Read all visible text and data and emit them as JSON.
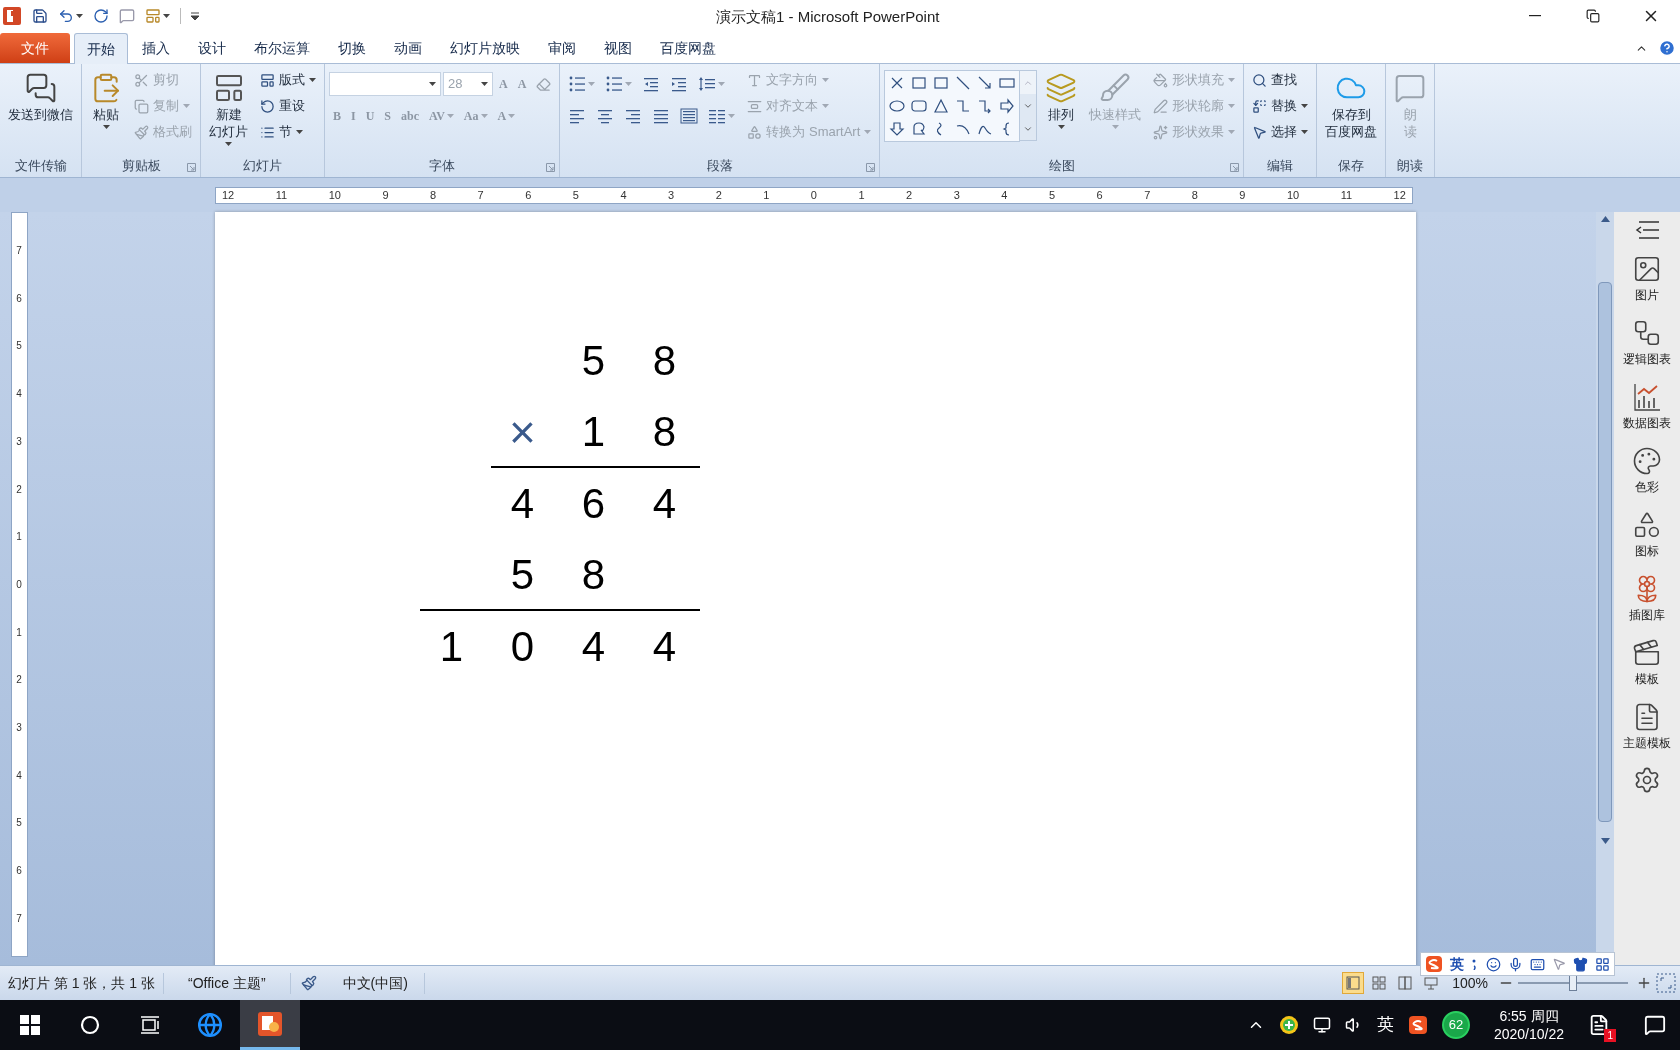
{
  "window": {
    "title": "演示文稿1 - Microsoft PowerPoint"
  },
  "tabs": [
    {
      "label": "文件",
      "kind": "file",
      "selected": false
    },
    {
      "label": "开始",
      "kind": "tab",
      "selected": true
    },
    {
      "label": "插入",
      "kind": "tab",
      "selected": false
    },
    {
      "label": "设计",
      "kind": "tab",
      "selected": false
    },
    {
      "label": "布尔运算",
      "kind": "tab",
      "selected": false
    },
    {
      "label": "切换",
      "kind": "tab",
      "selected": false
    },
    {
      "label": "动画",
      "kind": "tab",
      "selected": false
    },
    {
      "label": "幻灯片放映",
      "kind": "tab",
      "selected": false
    },
    {
      "label": "审阅",
      "kind": "tab",
      "selected": false
    },
    {
      "label": "视图",
      "kind": "tab",
      "selected": false
    },
    {
      "label": "百度网盘",
      "kind": "tab",
      "selected": false
    }
  ],
  "ribbon": {
    "groups": [
      {
        "label": "文件传输",
        "kind": "transfer",
        "items": [
          {
            "lines": [
              "发送到微信"
            ],
            "kind": "large",
            "disabled": false,
            "dropdown": false
          }
        ]
      },
      {
        "label": "剪贴板",
        "kind": "clipboard",
        "launcher": true,
        "items": [
          {
            "lines": [
              "粘贴"
            ],
            "kind": "large",
            "disabled": false,
            "dropdown": true
          },
          {
            "lines": [
              "剪切"
            ],
            "kind": "small",
            "disabled": true,
            "dropdown": false
          },
          {
            "lines": [
              "复制"
            ],
            "kind": "small",
            "disabled": true,
            "dropdown": true
          },
          {
            "lines": [
              "格式刷"
            ],
            "kind": "small",
            "disabled": true,
            "dropdown": false
          }
        ]
      },
      {
        "label": "幻灯片",
        "kind": "slides",
        "items": [
          {
            "lines": [
              "新建",
              "幻灯片"
            ],
            "kind": "large",
            "disabled": false,
            "dropdown": true
          },
          {
            "lines": [
              "版式"
            ],
            "kind": "small",
            "disabled": false,
            "dropdown": true
          },
          {
            "lines": [
              "重设"
            ],
            "kind": "small",
            "disabled": false,
            "dropdown": false
          },
          {
            "lines": [
              "节"
            ],
            "kind": "small",
            "disabled": false,
            "dropdown": true
          }
        ]
      },
      {
        "label": "字体",
        "kind": "font",
        "launcher": true,
        "top_items": [
          {
            "kind": "field",
            "disabled": true,
            "dropdown": true
          },
          {
            "kind": "field",
            "value": "28",
            "disabled": true,
            "dropdown": true
          },
          {
            "kind": "glyph",
            "label": "A",
            "disabled": true,
            "dropdown": false
          },
          {
            "kind": "glyph",
            "label": "A",
            "disabled": true,
            "dropdown": false
          },
          {
            "kind": "icon",
            "disabled": true,
            "dropdown": false
          }
        ],
        "bottom_items": [
          {
            "kind": "glyph",
            "label": "B",
            "disabled": true,
            "dropdown": false
          },
          {
            "kind": "glyph",
            "label": "I",
            "disabled": true,
            "dropdown": false
          },
          {
            "kind": "glyph",
            "label": "U",
            "disabled": true,
            "dropdown": false
          },
          {
            "kind": "glyph",
            "label": "S",
            "disabled": true,
            "dropdown": false
          },
          {
            "kind": "glyph",
            "label": "abc",
            "disabled": true,
            "dropdown": false
          },
          {
            "kind": "glyph",
            "label": "AV",
            "disabled": true,
            "dropdown": true
          },
          {
            "kind": "glyph",
            "label": "Aa",
            "disabled": true,
            "dropdown": true
          },
          {
            "kind": "glyph",
            "label": "A",
            "disabled": true,
            "dropdown": true
          }
        ]
      },
      {
        "label": "段落",
        "kind": "paragraph",
        "launcher": true,
        "top_items": [
          {
            "kind": "icon",
            "disabled": false,
            "dropdown": true
          },
          {
            "kind": "icon",
            "disabled": false,
            "dropdown": true
          },
          {
            "kind": "icon",
            "disabled": false,
            "dropdown": false
          },
          {
            "kind": "icon",
            "disabled": false,
            "dropdown": false
          },
          {
            "kind": "icon",
            "disabled": false,
            "dropdown": true
          }
        ],
        "bottom_items": [
          {
            "kind": "icon",
            "disabled": false,
            "dropdown": false
          },
          {
            "kind": "icon",
            "disabled": false,
            "dropdown": false
          },
          {
            "kind": "icon",
            "disabled": false,
            "dropdown": false
          },
          {
            "kind": "icon",
            "disabled": false,
            "dropdown": false
          },
          {
            "kind": "icon",
            "disabled": false,
            "dropdown": false
          },
          {
            "kind": "icon",
            "disabled": false,
            "dropdown": true
          }
        ],
        "items": [
          {
            "lines": [
              "文字方向"
            ],
            "kind": "small",
            "disabled": true,
            "dropdown": true
          },
          {
            "lines": [
              "对齐文本"
            ],
            "kind": "small",
            "disabled": true,
            "dropdown": true
          },
          {
            "lines": [
              "转换为 SmartArt"
            ],
            "kind": "small",
            "disabled": true,
            "dropdown": true
          }
        ]
      },
      {
        "label": "绘图",
        "kind": "drawing",
        "launcher": true,
        "items": [
          {
            "lines": [
              "排列"
            ],
            "kind": "large",
            "disabled": false,
            "dropdown": true
          },
          {
            "lines": [
              "快速样式"
            ],
            "kind": "large",
            "disabled": true,
            "dropdown": true
          },
          {
            "lines": [
              "形状填充"
            ],
            "kind": "small",
            "disabled": true,
            "dropdown": true
          },
          {
            "lines": [
              "形状轮廓"
            ],
            "kind": "small",
            "disabled": true,
            "dropdown": true
          },
          {
            "lines": [
              "形状效果"
            ],
            "kind": "small",
            "disabled": true,
            "dropdown": true
          }
        ]
      },
      {
        "label": "编辑",
        "kind": "editing",
        "items": [
          {
            "lines": [
              "查找"
            ],
            "kind": "small",
            "disabled": false,
            "dropdown": false
          },
          {
            "lines": [
              "替换"
            ],
            "kind": "small",
            "disabled": false,
            "dropdown": true
          },
          {
            "lines": [
              "选择"
            ],
            "kind": "small",
            "disabled": false,
            "dropdown": true
          }
        ]
      },
      {
        "label": "保存",
        "kind": "save",
        "items": [
          {
            "lines": [
              "保存到",
              "百度网盘"
            ],
            "kind": "large",
            "disabled": false,
            "dropdown": false
          }
        ]
      },
      {
        "label": "朗读",
        "kind": "read",
        "items": [
          {
            "lines": [
              "朗",
              "读"
            ],
            "kind": "large",
            "disabled": true,
            "dropdown": false
          }
        ]
      }
    ]
  },
  "rulers": {
    "horizontal": [
      "12",
      "11",
      "10",
      "9",
      "8",
      "7",
      "6",
      "5",
      "4",
      "3",
      "2",
      "1",
      "0",
      "1",
      "2",
      "3",
      "4",
      "5",
      "6",
      "7",
      "8",
      "9",
      "10",
      "11",
      "12"
    ],
    "vertical": [
      "7",
      "6",
      "5",
      "4",
      "3",
      "2",
      "1",
      "0",
      "1",
      "2",
      "3",
      "4",
      "5",
      "6",
      "7"
    ]
  },
  "slide": {
    "rows": [
      {
        "cells": [
          {
            "kind": "blank"
          },
          {
            "kind": "blank"
          },
          {
            "text": "5",
            "kind": "digit"
          },
          {
            "text": "8",
            "kind": "digit"
          }
        ]
      },
      {
        "cells": [
          {
            "kind": "blank"
          },
          {
            "text": "×",
            "kind": "operator"
          },
          {
            "text": "1",
            "kind": "digit"
          },
          {
            "text": "8",
            "kind": "digit"
          }
        ],
        "rule_below": true
      },
      {
        "cells": [
          {
            "kind": "blank"
          },
          {
            "text": "4",
            "kind": "digit"
          },
          {
            "text": "6",
            "kind": "digit"
          },
          {
            "text": "4",
            "kind": "digit"
          }
        ]
      },
      {
        "cells": [
          {
            "kind": "blank"
          },
          {
            "text": "5",
            "kind": "digit"
          },
          {
            "text": "8",
            "kind": "digit"
          },
          {
            "kind": "blank"
          }
        ],
        "rule_below": true
      },
      {
        "cells": [
          {
            "text": "1",
            "kind": "digit"
          },
          {
            "text": "0",
            "kind": "digit"
          },
          {
            "text": "4",
            "kind": "digit"
          },
          {
            "text": "4",
            "kind": "digit"
          }
        ]
      }
    ]
  },
  "side_pane": {
    "items": [
      {
        "label": "图片"
      },
      {
        "label": "逻辑图表"
      },
      {
        "label": "数据图表"
      },
      {
        "label": "色彩"
      },
      {
        "label": "图标"
      },
      {
        "label": "插图库"
      },
      {
        "label": "模板"
      },
      {
        "label": "主题模板"
      }
    ]
  },
  "status_bar": {
    "slide_info": "幻灯片 第 1 张，共 1 张",
    "theme": "“Office 主题”",
    "language": "中文(中国)",
    "views": [
      {
        "kind": "normal",
        "selected": true
      },
      {
        "kind": "sorter",
        "selected": false
      },
      {
        "kind": "reading",
        "selected": false
      },
      {
        "kind": "slideshow",
        "selected": false
      }
    ],
    "zoom": "100%",
    "zoom_slider": {
      "level": 0.5
    }
  },
  "ime_toolbar": {
    "mode": "英"
  },
  "taskbar": {
    "apps": [
      {
        "kind": "browser",
        "selected": false
      },
      {
        "kind": "powerpoint",
        "selected": true
      }
    ],
    "ime": "英",
    "security_badge": "62",
    "time": "6:55 周四",
    "date": "2020/10/22",
    "notifications": "1"
  }
}
